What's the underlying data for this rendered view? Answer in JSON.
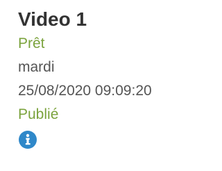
{
  "video": {
    "title": "Video 1",
    "status": "Prêt",
    "day": "mardi",
    "datetime": "25/08/2020 09:09:20",
    "publication_status": "Publié",
    "info_icon": "info-icon"
  },
  "colors": {
    "title": "#333333",
    "status_green": "#7ba33d",
    "text_gray": "#555555",
    "info_blue": "#2f88c9"
  }
}
